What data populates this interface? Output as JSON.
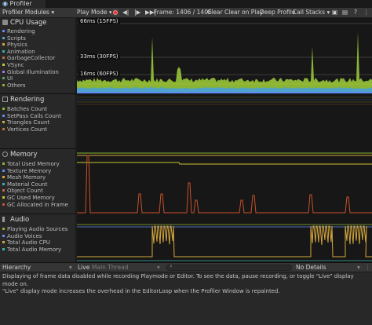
{
  "window": {
    "tab_title": "Profiler"
  },
  "toolbar": {
    "modules_dropdown": "Profiler Modules",
    "target_dropdown": "Play Mode",
    "frame_label": "Frame: 1406 / 1406",
    "clear": "Clear",
    "clear_on_play": "Clear on Play",
    "deep_profile": "Deep Profile",
    "call_stacks": "Call Stacks"
  },
  "modules": {
    "cpu": {
      "title": "CPU Usage",
      "items": [
        {
          "label": "Rendering",
          "color": "#5d8df6"
        },
        {
          "label": "Scripts",
          "color": "#4fa2c9"
        },
        {
          "label": "Physics",
          "color": "#d6a73c"
        },
        {
          "label": "Animation",
          "color": "#39b0a7"
        },
        {
          "label": "GarbageCollector",
          "color": "#c06e3d"
        },
        {
          "label": "VSync",
          "color": "#c9c431"
        },
        {
          "label": "Global Illumination",
          "color": "#9a7be6"
        },
        {
          "label": "UI",
          "color": "#53a36e"
        },
        {
          "label": "Others",
          "color": "#8ab436"
        }
      ],
      "markers": [
        "66ms (15FPS)",
        "33ms (30FPS)",
        "16ms (60FPS)"
      ]
    },
    "rendering": {
      "title": "Rendering",
      "items": [
        {
          "label": "Batches Count",
          "color": "#8ab436"
        },
        {
          "label": "SetPass Calls Count",
          "color": "#5d8df6"
        },
        {
          "label": "Triangles Count",
          "color": "#d6a73c"
        },
        {
          "label": "Vertices Count",
          "color": "#c06e3d"
        }
      ]
    },
    "memory": {
      "title": "Memory",
      "items": [
        {
          "label": "Total Used Memory",
          "color": "#8ab436"
        },
        {
          "label": "Texture Memory",
          "color": "#5d8df6"
        },
        {
          "label": "Mesh Memory",
          "color": "#d6a73c"
        },
        {
          "label": "Material Count",
          "color": "#39b0a7"
        },
        {
          "label": "Object Count",
          "color": "#c06e3d"
        },
        {
          "label": "GC Used Memory",
          "color": "#c9c431"
        },
        {
          "label": "GC Allocated in Frame",
          "color": "#c8522a"
        }
      ]
    },
    "audio": {
      "title": "Audio",
      "items": [
        {
          "label": "Playing Audio Sources",
          "color": "#8ab436"
        },
        {
          "label": "Audio Voices",
          "color": "#5d8df6"
        },
        {
          "label": "Total Audio CPU",
          "color": "#d6a73c"
        },
        {
          "label": "Total Audio Memory",
          "color": "#39b0a7"
        }
      ]
    }
  },
  "details": {
    "view_dropdown": "Hierarchy",
    "live_label": "Live",
    "thread_dropdown": "Main Thread",
    "details_dropdown": "No Details",
    "message_line1": "Displaying of frame data disabled while recording Playmode or Editor. To see the data, pause recording, or toggle \"Live\" display mode on.",
    "message_line2": "\"Live\" display mode increases the overhead in the EditorLoop when the Profiler Window is repainted."
  }
}
